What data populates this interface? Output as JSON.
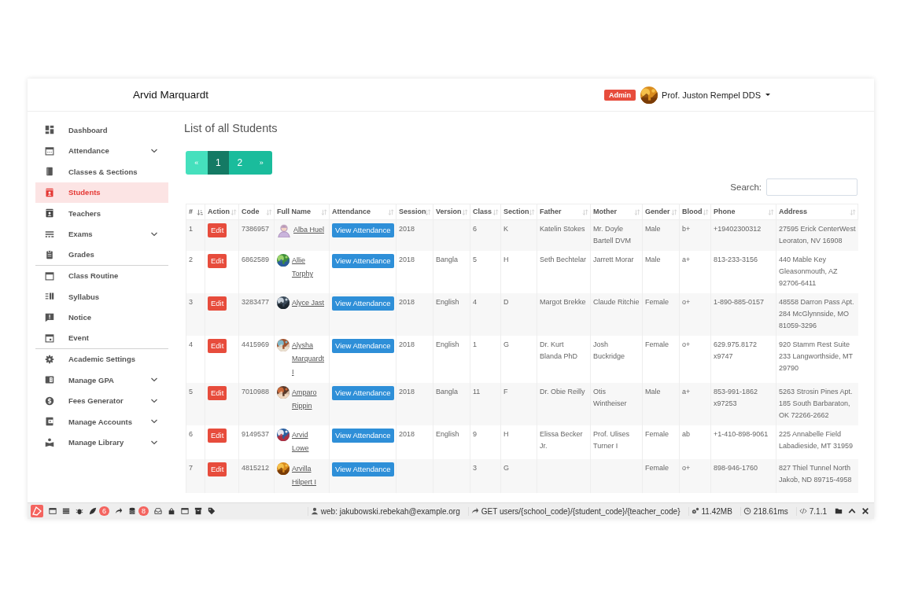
{
  "header": {
    "title": "Arvid Marquardt",
    "role_badge": "Admin",
    "user_name": "Prof. Juston Rempel DDS"
  },
  "sidebar": {
    "items": [
      {
        "label": "Dashboard",
        "selected": false,
        "has_submenu": false,
        "divider_after": false
      },
      {
        "label": "Attendance",
        "selected": false,
        "has_submenu": true,
        "divider_after": false
      },
      {
        "label": "Classes & Sections",
        "selected": false,
        "has_submenu": false,
        "divider_after": false
      },
      {
        "label": "Students",
        "selected": true,
        "has_submenu": false,
        "divider_after": false
      },
      {
        "label": "Teachers",
        "selected": false,
        "has_submenu": false,
        "divider_after": false
      },
      {
        "label": "Exams",
        "selected": false,
        "has_submenu": true,
        "divider_after": false
      },
      {
        "label": "Grades",
        "selected": false,
        "has_submenu": false,
        "divider_after": true
      },
      {
        "label": "Class Routine",
        "selected": false,
        "has_submenu": false,
        "divider_after": false
      },
      {
        "label": "Syllabus",
        "selected": false,
        "has_submenu": false,
        "divider_after": false
      },
      {
        "label": "Notice",
        "selected": false,
        "has_submenu": false,
        "divider_after": false
      },
      {
        "label": "Event",
        "selected": false,
        "has_submenu": false,
        "divider_after": true
      },
      {
        "label": "Academic Settings",
        "selected": false,
        "has_submenu": false,
        "divider_after": false
      },
      {
        "label": "Manage GPA",
        "selected": false,
        "has_submenu": true,
        "divider_after": false
      },
      {
        "label": "Fees Generator",
        "selected": false,
        "has_submenu": true,
        "divider_after": false
      },
      {
        "label": "Manage Accounts",
        "selected": false,
        "has_submenu": true,
        "divider_after": false
      },
      {
        "label": "Manage Library",
        "selected": false,
        "has_submenu": true,
        "divider_after": false
      }
    ]
  },
  "page_title": "List of all Students",
  "pagination": [
    {
      "label": "«",
      "selected": false,
      "disabled": true
    },
    {
      "label": "1",
      "selected": true,
      "disabled": false
    },
    {
      "label": "2",
      "selected": false,
      "disabled": false
    },
    {
      "label": "»",
      "selected": false,
      "disabled": false
    }
  ],
  "search": {
    "label": "Search:"
  },
  "table": {
    "columns": [
      {
        "label": "#",
        "sorted": true
      },
      {
        "label": "Action",
        "sorted": false
      },
      {
        "label": "Code",
        "sorted": false
      },
      {
        "label": "Full Name",
        "sorted": false
      },
      {
        "label": "Attendance",
        "sorted": false
      },
      {
        "label": "Session",
        "sorted": false
      },
      {
        "label": "Version",
        "sorted": false
      },
      {
        "label": "Class",
        "sorted": false
      },
      {
        "label": "Section",
        "sorted": false
      },
      {
        "label": "Father",
        "sorted": false
      },
      {
        "label": "Mother",
        "sorted": false
      },
      {
        "label": "Gender",
        "sorted": false
      },
      {
        "label": "Blood",
        "sorted": false
      },
      {
        "label": "Phone",
        "sorted": false
      },
      {
        "label": "Address",
        "sorted": false
      }
    ],
    "rows": [
      {
        "number": "1",
        "edit_button": "Edit",
        "code": "7386957",
        "kind": "icon",
        "full_name": "Alba Huel",
        "attendance_button": "View Attendance",
        "session": "2018",
        "class": "6",
        "section": "K",
        "father": "Katelin Stokes",
        "mother": "Mr. Doyle Bartell DVM",
        "gender": "Male",
        "blood": "b+",
        "phone": "+19402300312",
        "address": "27595 Erick CenterWest Leoraton, NV 16908"
      },
      {
        "number": "2",
        "edit_button": "Edit",
        "code": "6862589",
        "full_name": "Allie Torphy",
        "attendance_button": "View Attendance",
        "session": "2018",
        "version": "Bangla",
        "class": "5",
        "section": "H",
        "father": "Seth Bechtelar",
        "mother": "Jarrett Morar",
        "gender": "Male",
        "blood": "a+",
        "phone": "813-233-3156",
        "address": "440 Mable Key Gleasonmouth, AZ 92706-6411"
      },
      {
        "number": "3",
        "edit_button": "Edit",
        "code": "3283477",
        "full_name": "Alyce Jast",
        "attendance_button": "View Attendance",
        "session": "2018",
        "version": "English",
        "class": "4",
        "section": "D",
        "father": "Margot Brekke",
        "mother": "Claude Ritchie",
        "gender": "Female",
        "blood": "o+",
        "phone": "1-890-885-0157",
        "address": "48558 Darron Pass Apt. 284 McGlynnside, MO 81059-3296"
      },
      {
        "number": "4",
        "edit_button": "Edit",
        "code": "4415969",
        "full_name": "Alysha Marquardt I",
        "attendance_button": "View Attendance",
        "session": "2018",
        "version": "English",
        "class": "1",
        "section": "G",
        "father": "Dr. Kurt Blanda PhD",
        "mother": "Josh Buckridge",
        "gender": "Female",
        "blood": "o+",
        "phone": "629.975.8172 x9747",
        "address": "920 Stamm Rest Suite 233 Langworthside, MT 29790"
      },
      {
        "number": "5",
        "edit_button": "Edit",
        "code": "7010988",
        "full_name": "Amparo Rippin",
        "attendance_button": "View Attendance",
        "session": "2018",
        "version": "Bangla",
        "class": "11",
        "section": "F",
        "father": "Dr. Obie Reilly",
        "mother": "Otis Wintheiser",
        "gender": "Male",
        "blood": "a+",
        "phone": "853-991-1862 x97253",
        "address": "5263 Strosin Pines Apt. 185 South Barbaraton, OK 72266-2662"
      },
      {
        "number": "6",
        "edit_button": "Edit",
        "code": "9149537",
        "full_name": "Arvid Lowe",
        "attendance_button": "View Attendance",
        "session": "2018",
        "version": "English",
        "class": "9",
        "section": "H",
        "father": "Elissa Becker Jr.",
        "mother": "Prof. Ulises Turner I",
        "gender": "Female",
        "blood": "ab",
        "phone": "+1-410-898-9061",
        "address": "225 Annabelle Field Labadieside, MT 31959"
      },
      {
        "number": "7",
        "edit_button": "Edit",
        "code": "4815212",
        "full_name": "Arvilla Hilpert I",
        "attendance_button": "View Attendance",
        "class": "3",
        "section": "G",
        "gender": "Female",
        "blood": "o+",
        "phone": "898-946-1760",
        "address": "827 Thiel Tunnel North Jakob, ND 89715-4958"
      }
    ]
  },
  "debug_bar": {
    "badges": [
      "6",
      "8"
    ],
    "user": "web: jakubowski.rebekah@example.org",
    "route": "GET users/{school_code}/{student_code}/{teacher_code}",
    "memory": "11.42MB",
    "time": "218.61ms",
    "version": "7.1.1"
  }
}
